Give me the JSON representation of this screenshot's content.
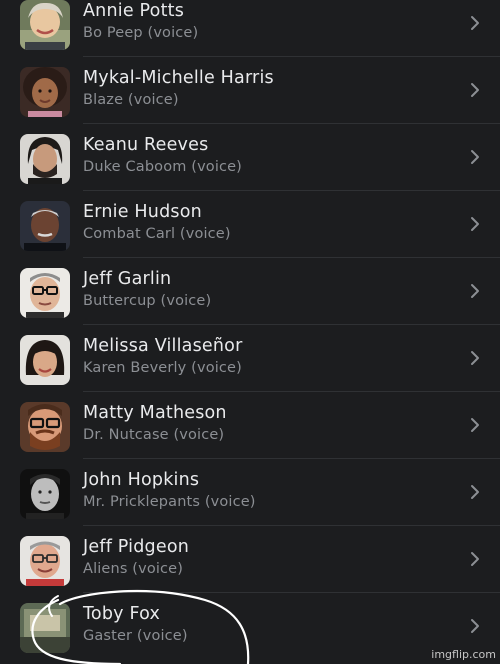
{
  "cast": [
    {
      "actor": "Annie Potts",
      "role": "Bo Peep (voice)",
      "avatar_icon": "headshot-photo"
    },
    {
      "actor": "Mykal-Michelle Harris",
      "role": "Blaze (voice)",
      "avatar_icon": "headshot-photo"
    },
    {
      "actor": "Keanu Reeves",
      "role": "Duke Caboom (voice)",
      "avatar_icon": "headshot-photo"
    },
    {
      "actor": "Ernie Hudson",
      "role": "Combat Carl (voice)",
      "avatar_icon": "headshot-photo"
    },
    {
      "actor": "Jeff Garlin",
      "role": "Buttercup (voice)",
      "avatar_icon": "headshot-photo"
    },
    {
      "actor": "Melissa Villaseñor",
      "role": "Karen Beverly (voice)",
      "avatar_icon": "headshot-photo"
    },
    {
      "actor": "Matty Matheson",
      "role": "Dr. Nutcase (voice)",
      "avatar_icon": "headshot-photo"
    },
    {
      "actor": "John Hopkins",
      "role": "Mr. Pricklepants (voice)",
      "avatar_icon": "headshot-photo"
    },
    {
      "actor": "Jeff Pidgeon",
      "role": "Aliens (voice)",
      "avatar_icon": "headshot-photo"
    },
    {
      "actor": "Toby Fox",
      "role": "Gaster (voice)",
      "avatar_icon": "headshot-photo"
    }
  ],
  "row_action_icon": "chevron-right-icon",
  "watermark": "imgflip.com",
  "colors": {
    "background": "#1c1d1f",
    "primary_text": "#e9eaec",
    "secondary_text": "#8c8f94",
    "divider": "#2f3134",
    "chevron": "#8c8f94",
    "annotation": "#ffffff"
  }
}
